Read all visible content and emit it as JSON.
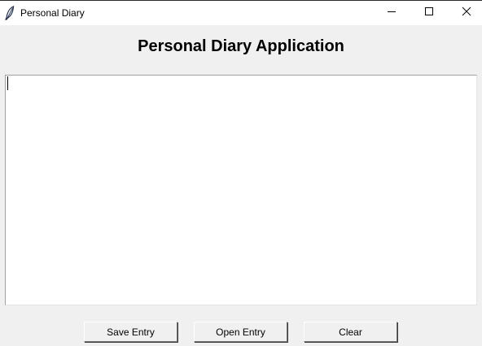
{
  "window": {
    "title": "Personal Diary",
    "icon": "feather-icon",
    "controls": [
      "minimize-icon",
      "maximize-icon",
      "close-icon"
    ]
  },
  "main": {
    "heading": "Personal Diary Application",
    "editor": {
      "value": ""
    }
  },
  "buttons": {
    "save_label": "Save Entry",
    "open_label": "Open Entry",
    "clear_label": "Clear"
  }
}
